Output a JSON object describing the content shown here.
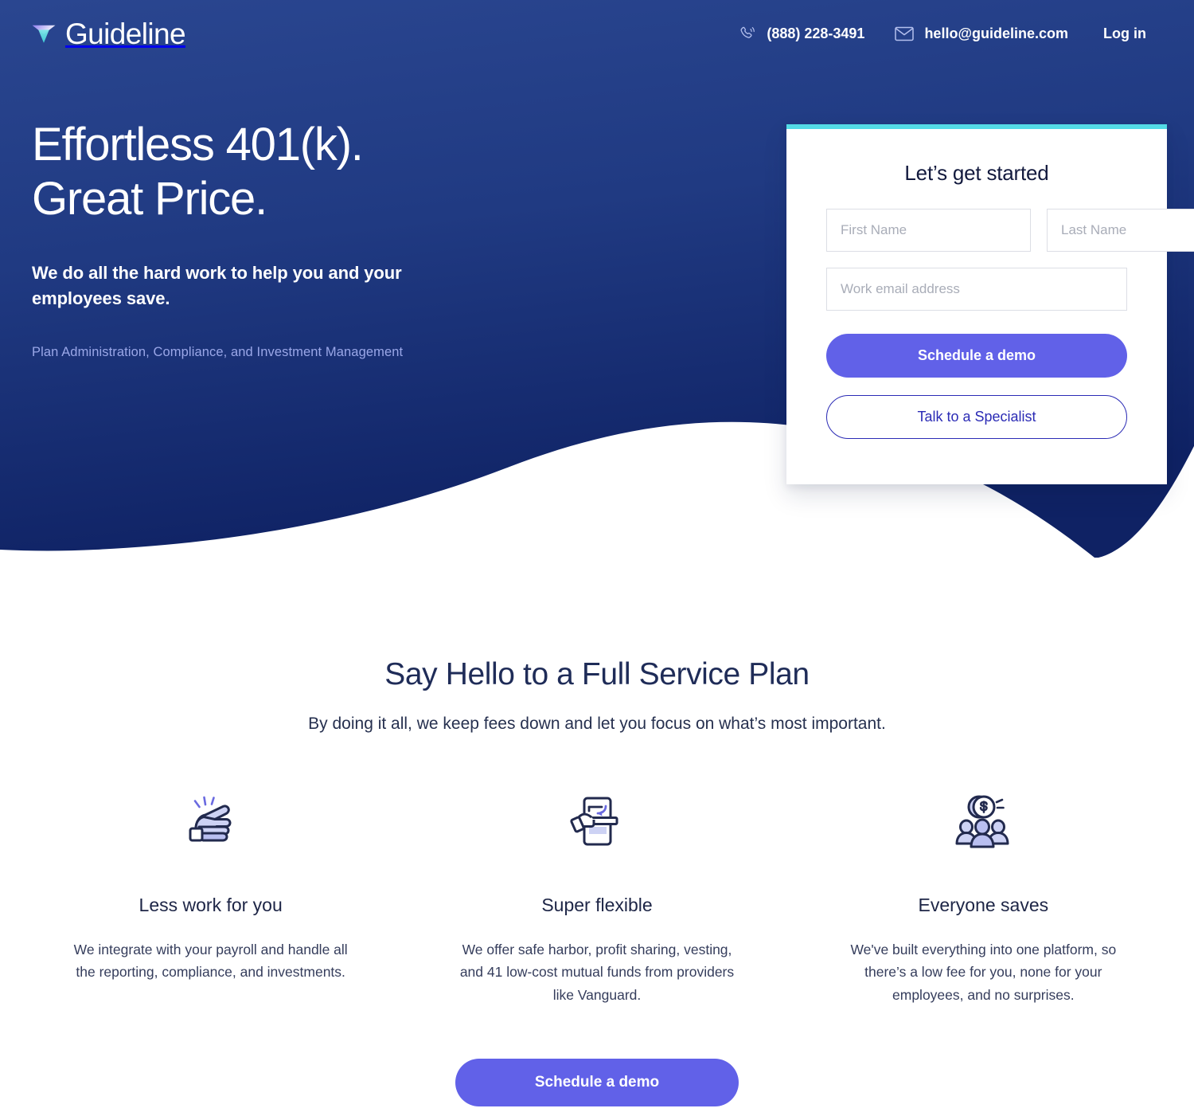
{
  "brand": {
    "name": "Guideline",
    "logo_icon": "guideline-triangle-logo",
    "colors": {
      "navy_top": "#264089",
      "navy_bottom": "#112569",
      "purple": "#6161e8",
      "cyan_accent": "#53dbe6",
      "outline_blue": "#2b2bb5",
      "muted_lavender": "#9aa7e8"
    }
  },
  "topbar": {
    "phone": {
      "icon": "phone-icon",
      "label": "(888) 228-3491"
    },
    "email": {
      "icon": "envelope-icon",
      "label": "hello@guideline.com"
    },
    "login_label": "Log in"
  },
  "hero": {
    "headline_line1": "Effortless 401(k).",
    "headline_line2": "Great Price.",
    "subhead": "We do all the hard work to help you and your employees save.",
    "note": "Plan Administration, Compliance, and Investment Management"
  },
  "form_card": {
    "title": "Let’s get started",
    "first_name": {
      "value": "",
      "placeholder": "First Name"
    },
    "last_name": {
      "value": "",
      "placeholder": "Last Name"
    },
    "work_email": {
      "value": "",
      "placeholder": "Work email address"
    },
    "primary_button": "Schedule a demo",
    "secondary_button": "Talk to a Specialist"
  },
  "services": {
    "title": "Say Hello to a Full Service Plan",
    "subtitle": "By doing it all, we keep fees down and let you focus on what’s most important.",
    "features": [
      {
        "icon": "pointing-hand-icon",
        "title": "Less work for you",
        "description": "We integrate with your payroll and handle all the reporting, compliance, and investments."
      },
      {
        "icon": "hand-adjusting-document-icon",
        "title": "Super flexible",
        "description": "We offer safe harbor, profit sharing, vesting, and 41 low-cost mutual funds from providers like Vanguard."
      },
      {
        "icon": "people-with-coin-icon",
        "title": "Everyone saves",
        "description": "We've built everything into one platform, so there’s a low fee for you, none for your employees, and no surprises."
      }
    ],
    "cta_button": "Schedule a demo"
  }
}
